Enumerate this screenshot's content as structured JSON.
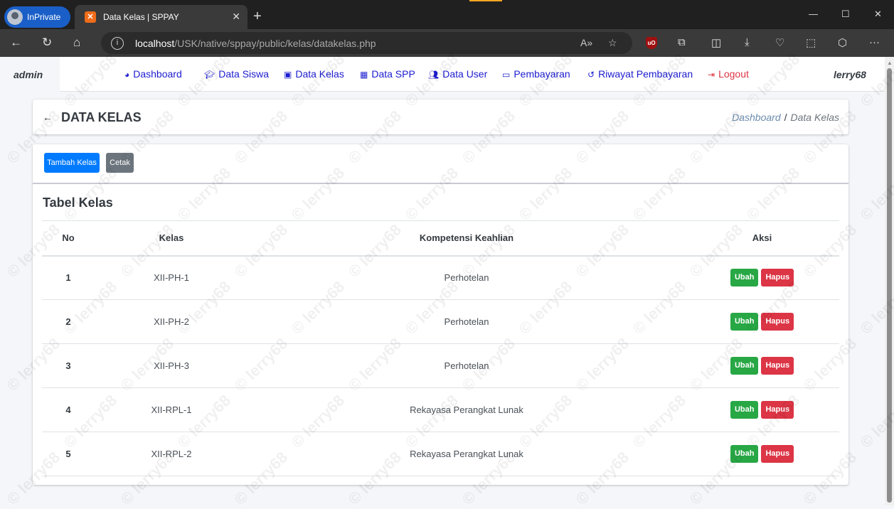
{
  "browser": {
    "inprivate_label": "InPrivate",
    "tab_title": "Data Kelas | SPPAY",
    "url_host": "localhost",
    "url_path": "/USK/native/sppay/public/kelas/datakelas.php"
  },
  "navbar": {
    "left_user": "admin",
    "right_user": "lerry68",
    "links": [
      {
        "label": "Dashboard",
        "icon": "tachometer-icon"
      },
      {
        "label": "Data Siswa",
        "icon": "graduation-cap-icon"
      },
      {
        "label": "Data Kelas",
        "icon": "id-badge-icon"
      },
      {
        "label": "Data SPP",
        "icon": "table-icon"
      },
      {
        "label": "Data User",
        "icon": "users-icon"
      },
      {
        "label": "Pembayaran",
        "icon": "money-bill-icon"
      },
      {
        "label": "Riwayat Pembayaran",
        "icon": "history-icon"
      },
      {
        "label": "Logout",
        "icon": "logout-icon"
      }
    ]
  },
  "header": {
    "title": "DATA KELAS",
    "breadcrumb_home": "Dashboard",
    "breadcrumb_sep": "/",
    "breadcrumb_current": "Data Kelas"
  },
  "actions": {
    "add_label": "Tambah Kelas",
    "print_label": "Cetak"
  },
  "table": {
    "title": "Tabel Kelas",
    "columns": [
      "No",
      "Kelas",
      "Kompetensi Keahlian",
      "Aksi"
    ],
    "edit_label": "Ubah",
    "delete_label": "Hapus",
    "rows": [
      {
        "no": "1",
        "kelas": "XII-PH-1",
        "kompetensi": "Perhotelan"
      },
      {
        "no": "2",
        "kelas": "XII-PH-2",
        "kompetensi": "Perhotelan"
      },
      {
        "no": "3",
        "kelas": "XII-PH-3",
        "kompetensi": "Perhotelan"
      },
      {
        "no": "4",
        "kelas": "XII-RPL-1",
        "kompetensi": "Rekayasa Perangkat Lunak"
      },
      {
        "no": "5",
        "kelas": "XII-RPL-2",
        "kompetensi": "Rekayasa Perangkat Lunak"
      }
    ]
  },
  "watermark_text": "© lerry68"
}
